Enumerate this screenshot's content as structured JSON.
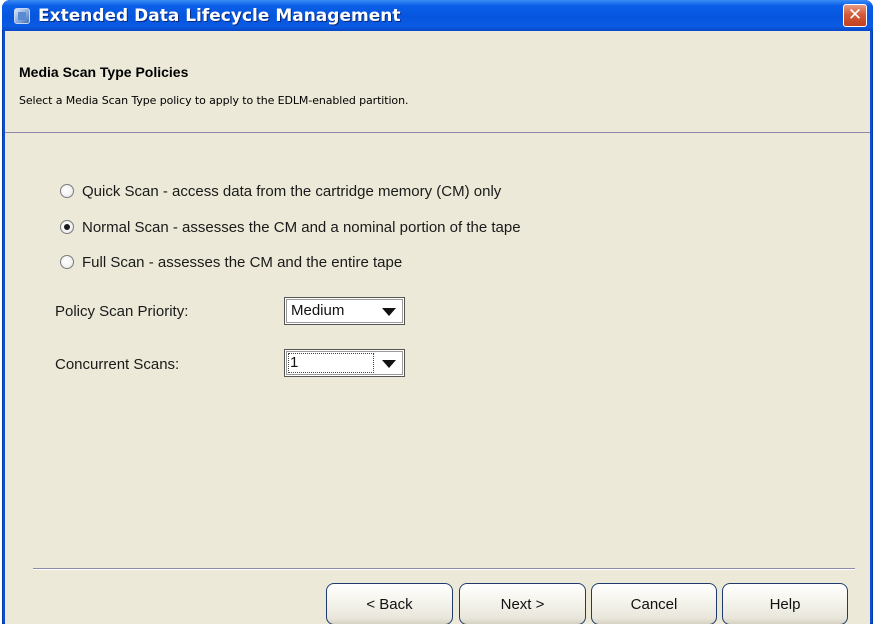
{
  "window": {
    "title": "Extended Data Lifecycle Management",
    "close_glyph": "✕"
  },
  "header": {
    "title": "Media Scan Type Policies",
    "description": "Select a Media Scan Type policy to apply to the EDLM-enabled partition."
  },
  "scan_options": [
    {
      "label": "Quick Scan - access data from the cartridge memory (CM) only",
      "checked": false
    },
    {
      "label": "Normal Scan - assesses the CM and a nominal portion of the tape",
      "checked": true
    },
    {
      "label": "Full Scan - assesses the CM and the entire tape",
      "checked": false
    }
  ],
  "priority": {
    "label": "Policy Scan Priority:",
    "value": "Medium"
  },
  "concurrent": {
    "label": "Concurrent Scans:",
    "value": "1"
  },
  "buttons": {
    "back": "< Back",
    "next": "Next >",
    "cancel": "Cancel",
    "help": "Help"
  },
  "icons": {
    "app": "app-icon",
    "close": "close-icon",
    "dropdown": "chevron-down-icon"
  },
  "colors": {
    "titlebar": "#0a5fe8",
    "dialog_background": "#ece9d8",
    "close_button": "#d35b3a"
  }
}
